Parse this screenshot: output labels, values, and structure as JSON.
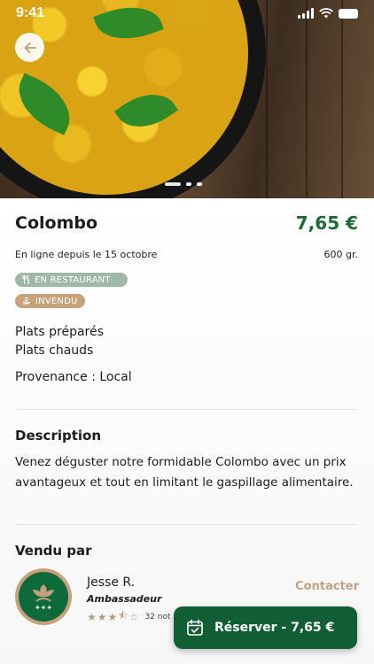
{
  "status_bar": {
    "time": "9:41"
  },
  "hero": {
    "image_alt": "Colombo",
    "carousel_pages": 3,
    "active_page": 1
  },
  "product": {
    "name": "Colombo",
    "price": "7,65 €",
    "online_since": "En ligne depuis le 15 octobre",
    "weight": "600 gr.",
    "badges": [
      {
        "label": "EN RESTAURANT",
        "icon": "fork-knife-icon",
        "color": "#9fb9a6"
      },
      {
        "label": "INVENDU",
        "icon": "hand-leaf-icon",
        "color": "#c8a27a"
      }
    ],
    "categories": [
      "Plats préparés",
      "Plats chauds"
    ],
    "provenance": "Provenance : Local"
  },
  "description": {
    "heading": "Description",
    "text": "Venez déguster notre formidable Colombo avec un prix avantageux et tout en limitant le gaspillage alimentaire."
  },
  "seller": {
    "heading": "Vendu par",
    "name": "Jesse R.",
    "role": "Ambassadeur",
    "rating": 3.5,
    "rating_count": "32 not",
    "contact_label": "Contacter"
  },
  "cta": {
    "label": "Réserver - 7,65 €",
    "icon": "calendar-check-icon"
  },
  "colors": {
    "brand_green": "#125f35",
    "price_green": "#1b6b34",
    "accent_tan": "#c2a27f"
  }
}
